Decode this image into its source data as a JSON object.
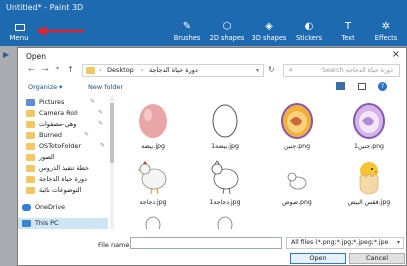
{
  "app": {
    "title": "Untitled* - Paint 3D",
    "menu_label": "Menu"
  },
  "toolbar": {
    "tools": [
      {
        "label": "Brushes",
        "icon": "brush-icon"
      },
      {
        "label": "2D shapes",
        "icon": "2d-shapes-icon"
      },
      {
        "label": "3D shapes",
        "icon": "3d-shapes-icon"
      },
      {
        "label": "Stickers",
        "icon": "stickers-icon"
      },
      {
        "label": "Text",
        "icon": "text-icon"
      },
      {
        "label": "Effects",
        "icon": "effects-icon"
      }
    ]
  },
  "annotation": {
    "arrow_color": "#e0242c"
  },
  "colors": {
    "accent": "#1d6ab0",
    "open_button_border": "#2a7ad5",
    "selection": "#cfe6f7"
  },
  "dialog": {
    "title": "Open",
    "address": {
      "root": "Desktop",
      "folder": "دورة حياة الدجاجة"
    },
    "search_placeholder": "Search دورة حياة الدجاجة",
    "organize_label": "Organize ▾",
    "new_folder_label": "New folder",
    "nav": [
      {
        "label": "Pictures",
        "pinned": true
      },
      {
        "label": "Camera Roll",
        "pinned": true
      },
      {
        "label": "وهي-مصفوات",
        "pinned": true
      },
      {
        "label": "Burned",
        "pinned": true
      },
      {
        "label": "OSTotoFolder",
        "pinned": true
      },
      {
        "label": "الصور",
        "pinned": false
      },
      {
        "label": "خطة تنفيذ الدروس",
        "pinned": false
      },
      {
        "label": "دورة حياة الدجاجة",
        "pinned": false
      },
      {
        "label": "التوضوعات نائبة",
        "pinned": false
      },
      {
        "label": "OneDrive",
        "pinned": false
      },
      {
        "label": "This PC",
        "pinned": false
      }
    ],
    "files": [
      {
        "name": "بيضة.jpg",
        "icon": "pink-egg-icon"
      },
      {
        "name": "بيضة1.jpg",
        "icon": "egg-outline-icon"
      },
      {
        "name": "جنين.png",
        "icon": "embryo-icon"
      },
      {
        "name": "جنين1.png",
        "icon": "embryo-outline-icon"
      },
      {
        "name": "دجاجة.jpg",
        "icon": "hen-icon"
      },
      {
        "name": "دجاجة1.jpg",
        "icon": "hen-outline-icon"
      },
      {
        "name": "صوص.png",
        "icon": "chick-outline-icon"
      },
      {
        "name": "فقس البيض.jpg",
        "icon": "hatching-chick-icon"
      }
    ],
    "file_name_label": "File name:",
    "file_name_value": "",
    "filter_value": "All files (*.png;*.jpg;*.jpeg;*.jpe",
    "open_label": "Open",
    "cancel_label": "Cancel"
  }
}
